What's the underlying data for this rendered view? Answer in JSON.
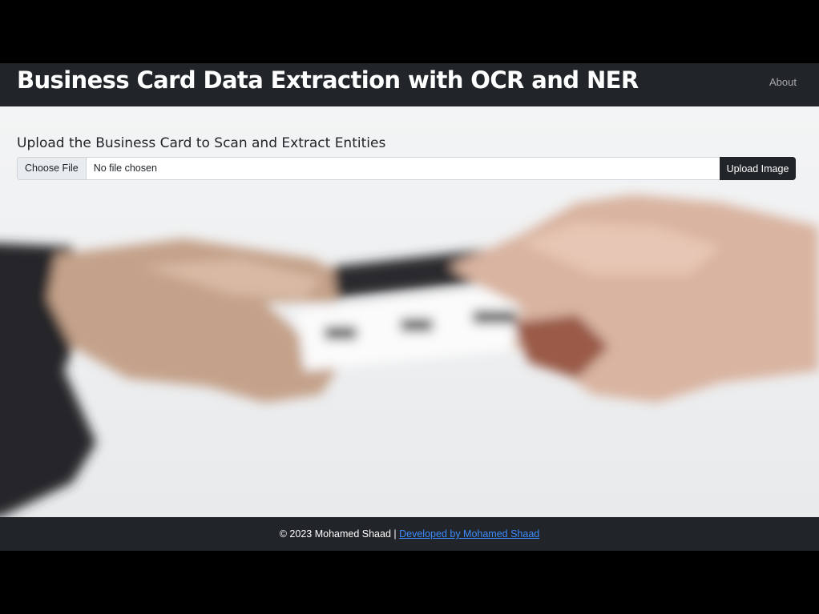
{
  "navbar": {
    "brand": "Business Card Data Extraction with OCR and NER",
    "links": [
      {
        "label": "About"
      }
    ]
  },
  "upload": {
    "heading": "Upload the Business Card to Scan and Extract Entities",
    "choose_file_label": "Choose File",
    "file_status": "No file chosen",
    "submit_label": "Upload Image"
  },
  "background": {
    "description_icon": "hands-exchanging-business-card-photo"
  },
  "footer": {
    "copyright": "© 2023 Mohamed Shaad |",
    "link_text": "Developed by Mohamed Shaad"
  },
  "colors": {
    "navbar_bg": "#212529",
    "footer_bg": "#212529",
    "button_bg": "#212529",
    "link": "#3d8bfd"
  }
}
